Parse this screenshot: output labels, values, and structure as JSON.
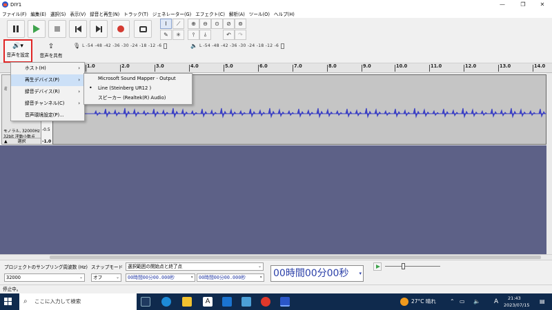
{
  "window": {
    "title": "DIY1",
    "minimize": "—",
    "restore": "❐",
    "close": "✕"
  },
  "menubar": {
    "items": [
      "ファイル(F)",
      "編集(E)",
      "選択(S)",
      "表示(V)",
      "録音と再生(N)",
      "トラック(T)",
      "ジェネレーター(G)",
      "エフェクト(C)",
      "解析(A)",
      "ツール(O)",
      "ヘルプ(H)"
    ]
  },
  "toolbar": {
    "audio_setup_label": "音声を設定",
    "share_audio_label": "音声を共有",
    "meter_play_ticks": "-54 -48 -42 -36 -30 -24 -18 -12 -6",
    "meter_rec_ticks": "-54 -48 -42 -36 -30 -24 -18 -12 -6",
    "meter_rec_l": "L",
    "meter_rec_r": "R",
    "meter_play_l": "L",
    "meter_play_r": "R"
  },
  "ruler": {
    "ticks": [
      "1.0",
      "2.0",
      "3.0",
      "4.0",
      "5.0",
      "6.0",
      "7.0",
      "8.0",
      "9.0",
      "10.0",
      "11.0",
      "12.0",
      "13.0",
      "14.0"
    ]
  },
  "track": {
    "info_line1": "モノラル, 32000Hz",
    "info_line2": "32bit 浮動小数点",
    "select_button": "選択",
    "scale_top": "-0.5",
    "scale_bottom": "-1.0",
    "name_initial": "ミ"
  },
  "menus": {
    "audio_setup": [
      {
        "label": "ホスト(H)",
        "has_submenu": true
      },
      {
        "label": "再生デバイス(P)",
        "has_submenu": true
      },
      {
        "label": "録音デバイス(R)",
        "has_submenu": true
      },
      {
        "label": "録音チャンネル(C)",
        "has_submenu": true
      },
      {
        "label": "音声環境設定(P)...",
        "has_submenu": false
      }
    ],
    "playback_devices": [
      {
        "label": "Microsoft Sound Mapper - Output",
        "selected": false
      },
      {
        "label": "Line (Steinberg UR12 )",
        "selected": true
      },
      {
        "label": "スピーカー (Realtek(R) Audio)",
        "selected": false
      }
    ]
  },
  "selection_toolbar": {
    "project_rate_label": "プロジェクトのサンプリング周波数 (Hz)",
    "project_rate_value": "32000",
    "snap_label": "スナップモード",
    "snap_value": "オフ",
    "selection_mode": "選択範囲の開始点と終了点",
    "sel_start": "00時間00分00.000秒",
    "sel_end": "00時間00分00.000秒",
    "time_display": "00時間00分00秒"
  },
  "status": {
    "text": "停止中。"
  },
  "taskbar": {
    "search_placeholder": "ここに入力して検索",
    "weather": "27°C 晴れ",
    "ime": "A",
    "time": "21:43",
    "date": "2023/07/15"
  }
}
